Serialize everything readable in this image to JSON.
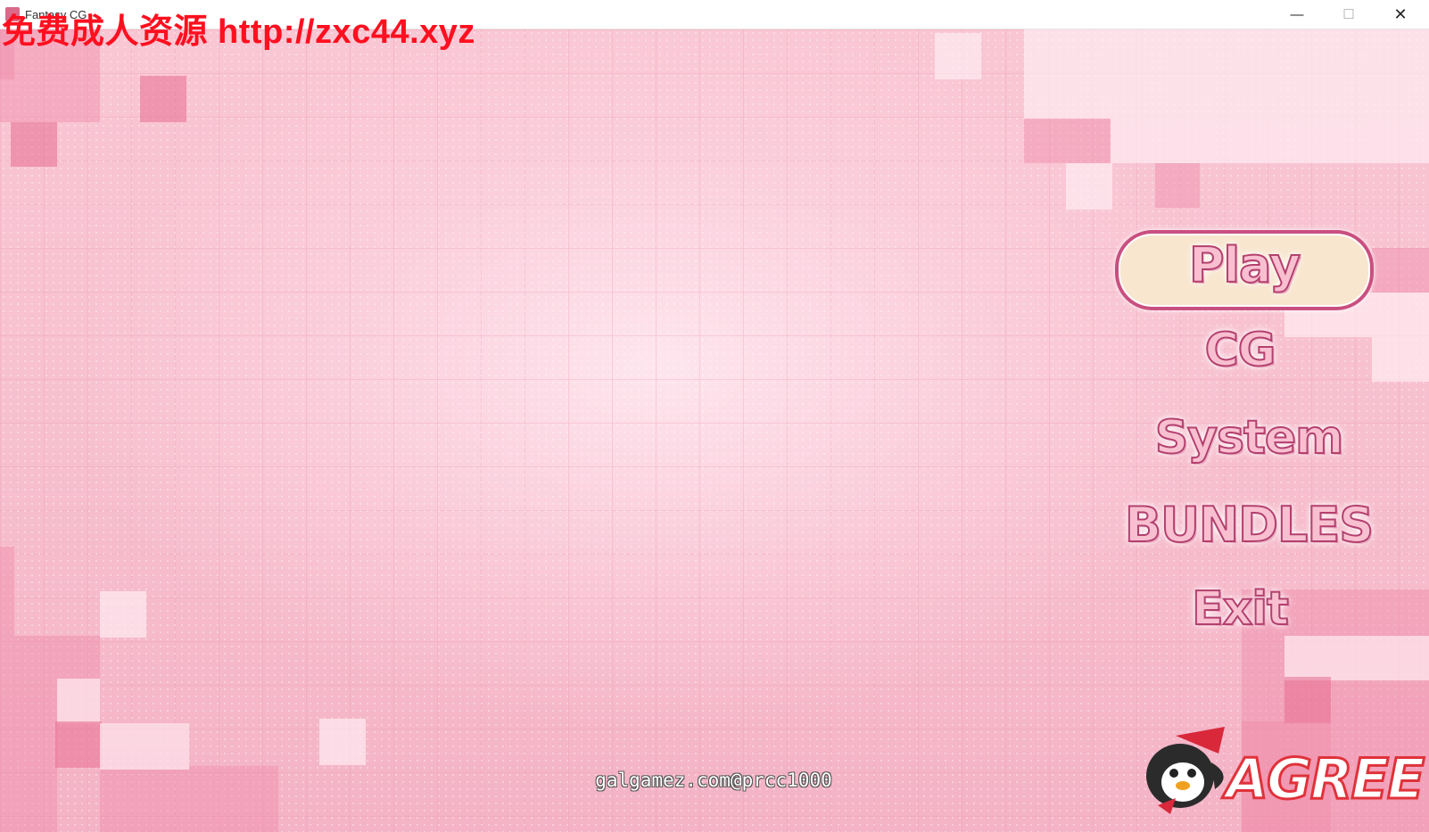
{
  "window": {
    "title": "Fantasy CG",
    "minimize": "—",
    "maximize": "☐",
    "close": "✕"
  },
  "watermark": "免费成人资源 http://zxc44.xyz",
  "menu": {
    "play": "Play",
    "cg": "CG",
    "system": "System",
    "bundles": "BUNDLES",
    "exit": "Exit"
  },
  "credit": "galgamez.com@prcc1000",
  "logo": {
    "text": "AGREE",
    "accent": "#e0323a"
  },
  "colors": {
    "background": "#f7c0cf",
    "menu_outline": "#b4406e",
    "menu_fill": "#f8bfd0",
    "pill_fill": "#f8e6cf",
    "watermark": "#ff0f1f"
  }
}
